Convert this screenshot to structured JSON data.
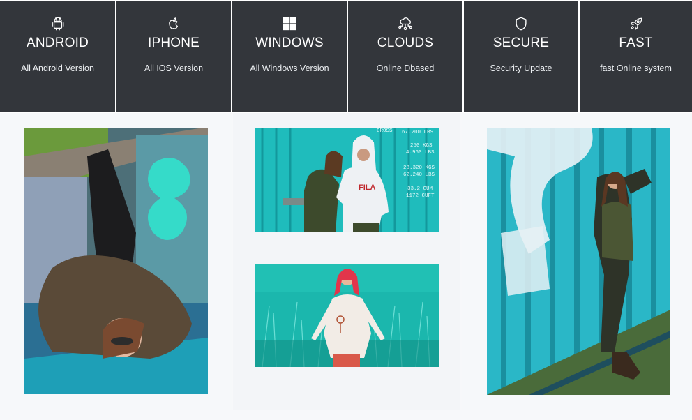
{
  "features": [
    {
      "icon": "android-icon",
      "title": "ANDROID",
      "description": "All Android Version"
    },
    {
      "icon": "apple-icon",
      "title": "IPHONE",
      "description": "All IOS Version"
    },
    {
      "icon": "windows-icon",
      "title": "WINDOWS",
      "description": "All Windows Version"
    },
    {
      "icon": "cloud-network-icon",
      "title": "CLOUDS",
      "description": "Online Dbased"
    },
    {
      "icon": "shield-icon",
      "title": "SECURE",
      "description": "Security Update"
    },
    {
      "icon": "rocket-icon",
      "title": "FAST",
      "description": "fast Online system"
    }
  ],
  "gallery": {
    "photo_texts": {
      "hoodie_brand": "FILA",
      "container_markings": [
        "67.200 LBS",
        "250 KGS",
        "4.960 LBS",
        "28.320 KGS",
        "62.240 LBS",
        "33.2 CUM",
        "1172 CUFT",
        "CROSS"
      ]
    }
  },
  "colors": {
    "tile_background": "#33363b",
    "teal_accent": "#1fc8c8",
    "gallery_background": "#f7f8fa"
  }
}
